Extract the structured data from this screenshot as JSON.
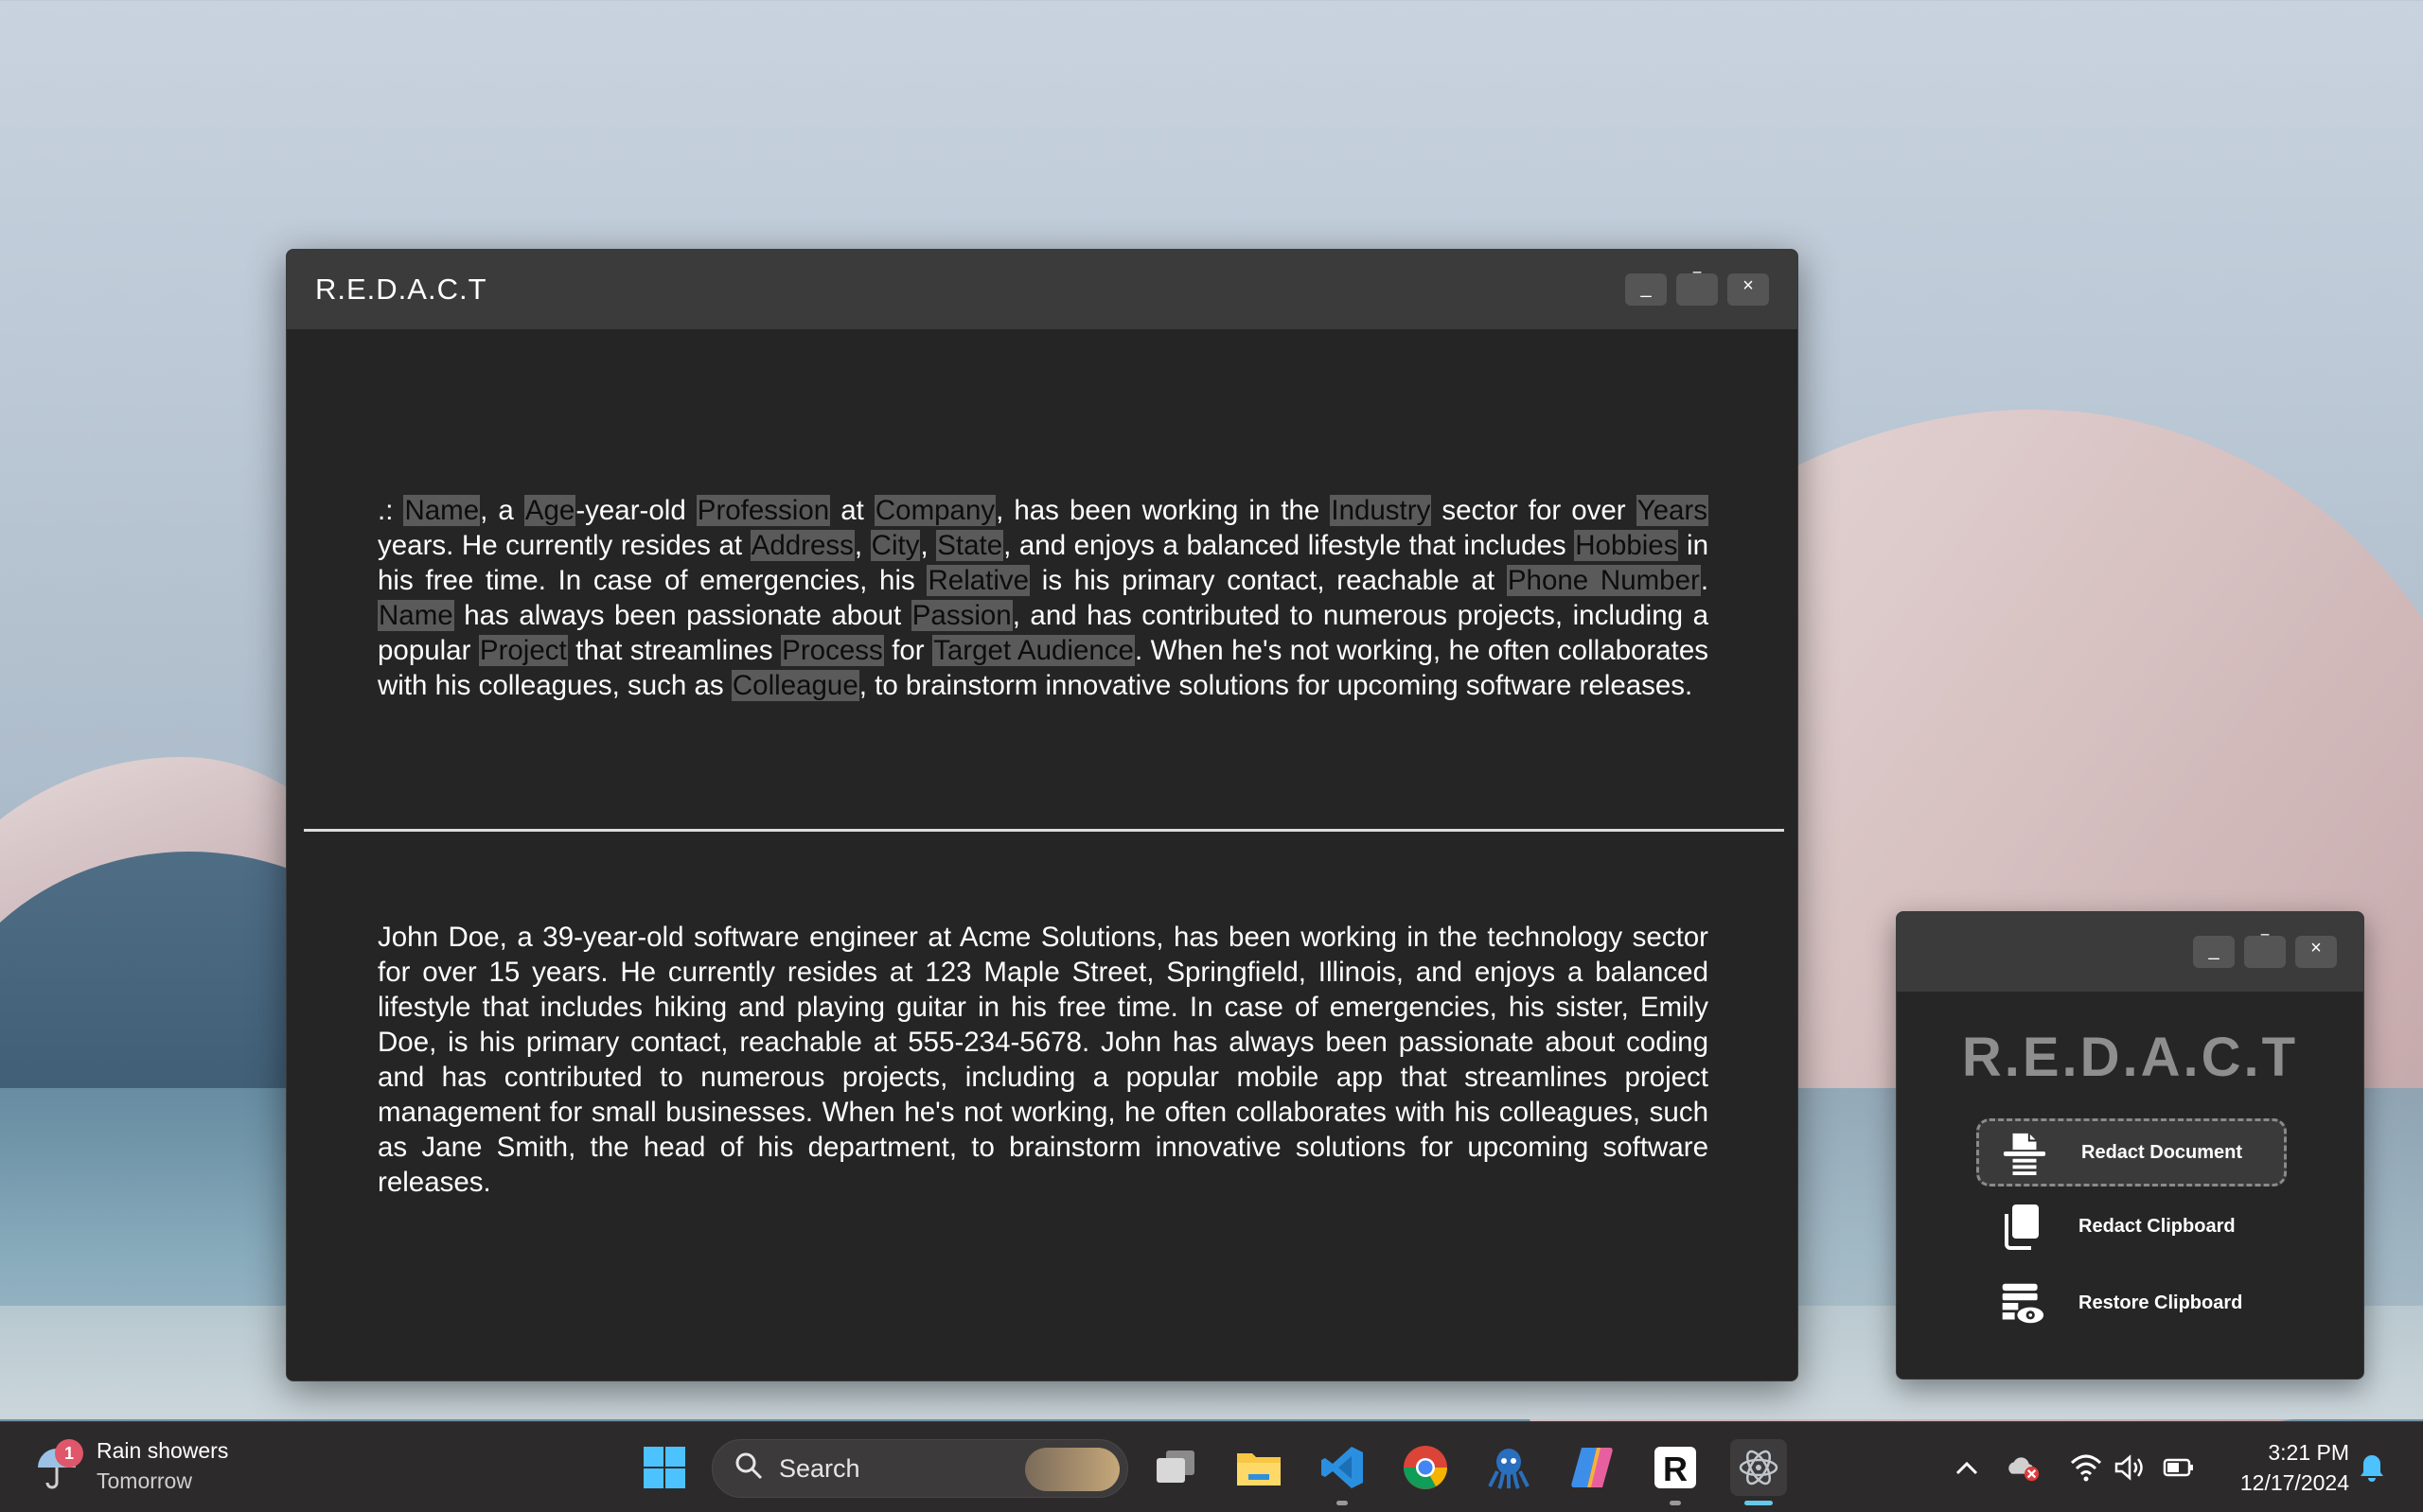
{
  "main_window": {
    "title": "R.E.D.A.C.T",
    "controls": {
      "minimize": "_",
      "maximize": "‾",
      "close": "×"
    },
    "redacted_segments": [
      {
        "t": ".: ",
        "ph": false
      },
      {
        "t": "Name",
        "ph": true
      },
      {
        "t": ", a ",
        "ph": false
      },
      {
        "t": "Age",
        "ph": true
      },
      {
        "t": "-year-old ",
        "ph": false
      },
      {
        "t": "Profession",
        "ph": true
      },
      {
        "t": " at ",
        "ph": false
      },
      {
        "t": "Company",
        "ph": true
      },
      {
        "t": ", has been working in the ",
        "ph": false
      },
      {
        "t": "Industry",
        "ph": true
      },
      {
        "t": " sector for over ",
        "ph": false
      },
      {
        "t": "Years",
        "ph": true
      },
      {
        "t": " years. He currently resides at ",
        "ph": false
      },
      {
        "t": "Address",
        "ph": true
      },
      {
        "t": ", ",
        "ph": false
      },
      {
        "t": "City",
        "ph": true
      },
      {
        "t": ", ",
        "ph": false
      },
      {
        "t": "State",
        "ph": true
      },
      {
        "t": ", and enjoys a balanced lifestyle that includes ",
        "ph": false
      },
      {
        "t": "Hobbies",
        "ph": true
      },
      {
        "t": " in his free time. In case of emergencies, his ",
        "ph": false
      },
      {
        "t": "Relative",
        "ph": true
      },
      {
        "t": " is his primary contact, reachable at ",
        "ph": false
      },
      {
        "t": "Phone Number",
        "ph": true
      },
      {
        "t": ". ",
        "ph": false
      },
      {
        "t": "Name",
        "ph": true
      },
      {
        "t": " has always been passionate about ",
        "ph": false
      },
      {
        "t": "Passion",
        "ph": true
      },
      {
        "t": ", and has contributed to numerous projects, including a popular ",
        "ph": false
      },
      {
        "t": "Project",
        "ph": true
      },
      {
        "t": " that streamlines ",
        "ph": false
      },
      {
        "t": "Process",
        "ph": true
      },
      {
        "t": " for ",
        "ph": false
      },
      {
        "t": "Target Audience",
        "ph": true
      },
      {
        "t": ". When he's not working, he often collaborates with his colleagues, such as ",
        "ph": false
      },
      {
        "t": "Colleague",
        "ph": true
      },
      {
        "t": ", to brainstorm innovative solutions for upcoming software releases.",
        "ph": false
      }
    ],
    "original_text": "John Doe, a 39-year-old software engineer at Acme Solutions, has been working in the technology sector for over 15 years. He currently resides at 123 Maple Street, Springfield, Illinois, and enjoys a balanced lifestyle that includes hiking and playing guitar in his free time. In case of emergencies, his sister, Emily Doe, is his primary contact, reachable at 555-234-5678. John has always been passionate about coding and has contributed to numerous projects, including a popular mobile app that streamlines project management for small businesses. When he's not working, he often collaborates with his colleagues, such as Jane Smith, the head of his department, to brainstorm innovative solutions for upcoming software releases."
  },
  "launcher": {
    "title": "R.E.D.A.C.T",
    "controls": {
      "minimize": "_",
      "maximize": "‾",
      "close": "×"
    },
    "actions": [
      {
        "label": "Redact Document",
        "icon": "document-redact-icon"
      },
      {
        "label": "Redact Clipboard",
        "icon": "clipboard-copy-icon"
      },
      {
        "label": "Restore Clipboard",
        "icon": "clipboard-restore-eye-icon"
      }
    ]
  },
  "taskbar": {
    "weather": {
      "title": "Rain showers",
      "subtitle": "Tomorrow",
      "badge": "1",
      "icon": "umbrella-rain-icon"
    },
    "search_label": "Search",
    "apps": [
      "windows-start-icon",
      "task-view-icon",
      "file-explorer-icon",
      "vscode-icon",
      "chrome-icon",
      "octopus-app-icon",
      "copilot-icon",
      "redact-r-icon",
      "electron-app-icon"
    ],
    "tray": [
      "chevron-up-icon",
      "onedrive-error-icon",
      "wifi-icon",
      "volume-icon",
      "battery-icon",
      "notification-bell-icon"
    ],
    "clock": {
      "time": "3:21 PM",
      "date": "12/17/2024"
    }
  },
  "colors": {
    "window_bg": "#252525",
    "titlebar_bg": "#3b3b3b",
    "placeholder_bg": "#5a5a5a",
    "launcher_title": "#8e8e8e",
    "taskbar_bg": "#2d2a2b"
  }
}
